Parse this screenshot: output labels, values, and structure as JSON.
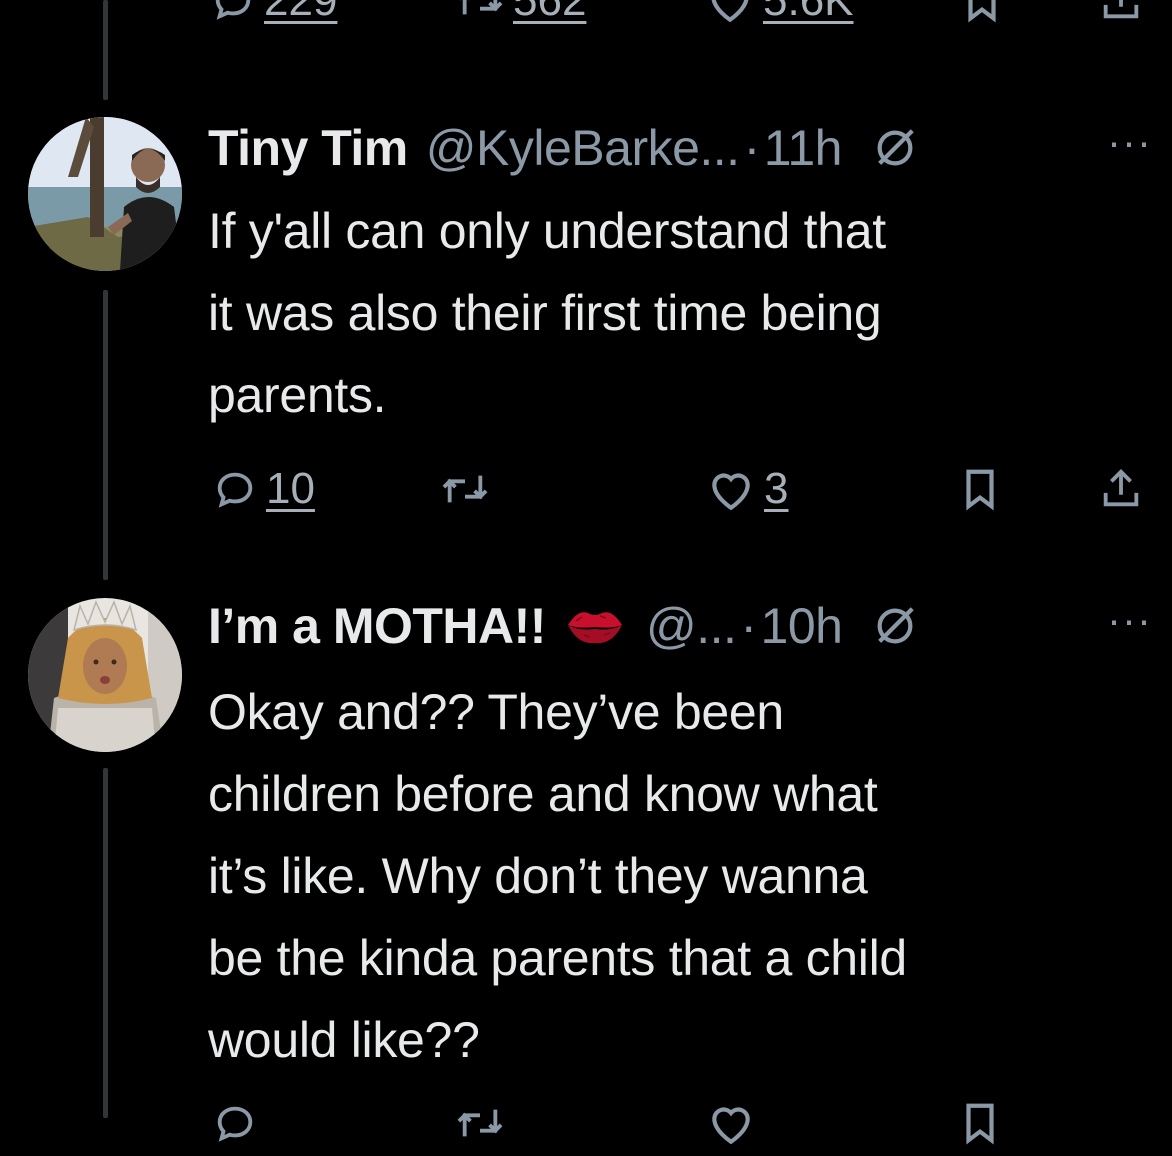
{
  "top_actions": {
    "replies": "229",
    "reposts": "562",
    "likes": "5.6K"
  },
  "tweets": [
    {
      "display_name": "Tiny Tim",
      "handle": "@KyleBarke...",
      "separator": "·",
      "time": "11h",
      "more": "···",
      "avatar_icon": "profile-photo-man-by-lake",
      "text_lines": [
        "If y'all can only understand that",
        "it was also their first time being",
        "parents."
      ],
      "actions": {
        "replies": "10",
        "reposts": "",
        "likes": "3"
      }
    },
    {
      "display_name": "I’m a MOTHA!!",
      "emoji_icon": "lips-kiss-emoji",
      "handle": "@...",
      "separator": "·",
      "time": "10h",
      "more": "···",
      "avatar_icon": "profile-photo-woman-with-crown",
      "text_lines": [
        "Okay and?? They’ve been",
        "children before and know what",
        "it’s like. Why don’t they wanna",
        "be the kinda parents that a child",
        "would like??"
      ]
    }
  ],
  "colors": {
    "background": "#000000",
    "text_primary": "#e7e9ea",
    "text_secondary": "#8b98a5",
    "thread_line": "#333639"
  }
}
